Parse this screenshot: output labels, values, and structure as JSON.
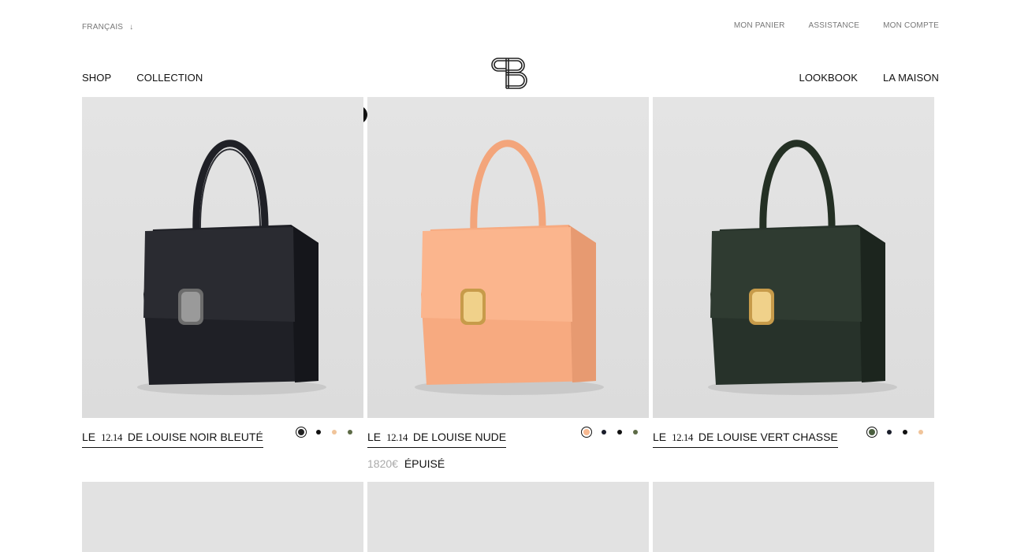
{
  "header": {
    "language": "FRANÇAIS",
    "utility_links": [
      "MON PANIER",
      "ASSISTANCE",
      "MON COMPTE"
    ],
    "nav_left": [
      "SHOP",
      "COLLECTION"
    ],
    "nav_right": [
      "LOOKBOOK",
      "LA MAISON"
    ]
  },
  "products": [
    {
      "prefix": "LE",
      "number": "12.14",
      "name": "DE LOUISE NOIR BLEUTÉ",
      "bag_color": "#1f2026",
      "swatches": [
        "#222222",
        "#111111",
        "#f0c49a",
        "#5d6b46"
      ],
      "active_swatch": 0,
      "price": "",
      "status": ""
    },
    {
      "prefix": "LE",
      "number": "12.14",
      "name": "DE LOUISE NUDE",
      "bag_color": "#f7aa80",
      "swatches": [
        "#f7b890",
        "#1a1d2a",
        "#111111",
        "#5d6b46"
      ],
      "active_swatch": 0,
      "price": "1820€",
      "status": "ÉPUISÉ"
    },
    {
      "prefix": "LE",
      "number": "12.14",
      "name": "DE LOUISE VERT CHASSE",
      "bag_color": "#27322a",
      "swatches": [
        "#4a5e3e",
        "#1a1d2a",
        "#111111",
        "#f0c49a"
      ],
      "active_swatch": 0,
      "price": "",
      "status": ""
    }
  ]
}
